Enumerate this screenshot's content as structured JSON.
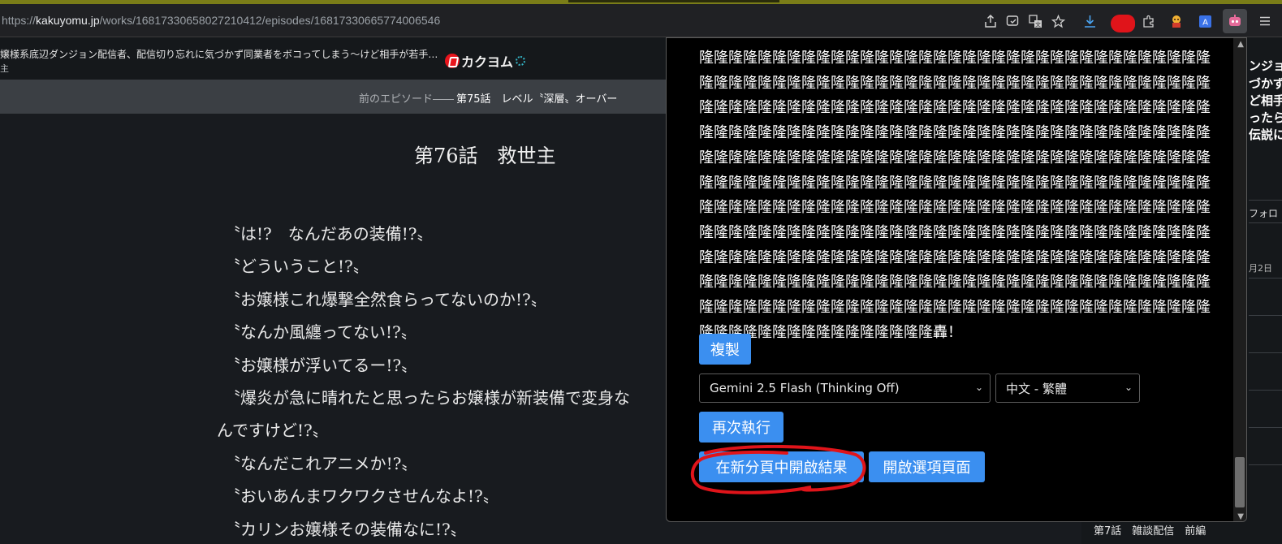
{
  "browser": {
    "url_scheme": "https://",
    "url_host": "kakuyomu.jp",
    "url_path": "/works/16817330658027210412/episodes/16817330665774006546",
    "toolbar_icons": [
      "share-icon",
      "install-icon",
      "translate-icon",
      "bookmark-star-icon",
      "download-icon",
      "extension-red-icon",
      "extensions-puzzle-icon",
      "extension-character-icon",
      "extension-translate-icon",
      "extension-bot-icon",
      "menu-icon"
    ]
  },
  "site": {
    "series_title": "嬢様系底辺ダンジョン配信者、配信切り忘れに気づかず同業者をボコってしまう〜けど相手が若手…",
    "series_sub": "主",
    "logo_text": "カクヨム"
  },
  "nav": {
    "prev_label": "前のエピソード――",
    "current_label": "第75話　レベル〝深層〟オーバー"
  },
  "episode": {
    "title": "第76話　救世主",
    "lines": [
      "〝は!?　なんだあの装備!?〟",
      "〝どういうこと!?〟",
      "〝お嬢様これ爆撃全然食らってないのか!?〟",
      "〝なんか風纏ってない!?〟",
      "〝お嬢様が浮いてるー!?〟",
      "〝爆炎が急に晴れたと思ったらお嬢様が新装備で変身な",
      "んですけど!?〟",
      "〝なんだこれアニメか!?〟",
      "〝おいあんまワクワクさせんなよ!?〟",
      "〝カリンお嬢様その装備なに!?〟"
    ]
  },
  "right_panel": {
    "heading_lines": [
      "ンジョ",
      "づかず",
      "ど相手",
      "ったら",
      "伝説に"
    ],
    "follow_label": "フォロ",
    "date_text": "月2日",
    "bottom_link": "第7話　雑談配信　前編"
  },
  "popup": {
    "result_text": "隆隆隆隆隆隆隆隆隆隆隆隆隆隆隆隆隆隆隆隆隆隆隆隆隆隆隆隆隆隆隆隆隆隆隆隆隆隆隆隆隆隆隆隆隆隆隆隆隆隆隆隆隆隆隆隆隆隆隆隆隆隆隆隆隆隆隆隆隆隆隆隆隆隆隆隆隆隆隆隆隆隆隆隆隆隆隆隆隆隆隆隆隆隆隆隆隆隆隆隆隆隆隆隆隆隆隆隆隆隆隆隆隆隆隆隆隆隆隆隆隆隆隆隆隆隆隆隆隆隆隆隆隆隆隆隆隆隆隆隆隆隆隆隆隆隆隆隆隆隆隆隆隆隆隆隆隆隆隆隆隆隆隆隆隆隆隆隆隆隆隆隆隆隆隆隆隆隆隆隆隆隆隆隆隆隆隆隆隆隆隆隆隆隆隆隆隆隆隆隆隆隆隆隆隆隆隆隆隆隆隆隆隆隆隆隆隆隆隆隆隆隆隆隆隆隆隆隆隆隆隆隆隆隆隆隆隆隆隆隆隆隆隆隆隆隆隆隆隆隆隆隆隆隆隆隆隆隆隆隆隆隆隆隆隆隆隆隆隆隆隆隆隆隆隆隆隆隆隆隆隆隆隆隆隆隆隆隆隆隆隆隆隆隆隆隆隆隆隆隆隆隆隆隆隆隆隆隆隆隆隆隆隆隆隆隆隆隆隆隆隆隆隆隆隆隆隆隆隆隆隆隆隆隆隆隆隆隆隆隆隆隆隆隆隆隆隆隆隆隆隆隆隆隆隆隆隆隆隆隆隆隆隆隆隆隆隆隆隆隆隆隆隆隆隆隆隆隆隆隆隆隆隆隆隆隆隆隆隆隆隆隆隆隆隆隆隆隆隆隆隆轟！",
    "copy_label": "複製",
    "model_select": "Gemini 2.5 Flash (Thinking Off)",
    "language_select": "中文 - 繁體",
    "rerun_label": "再次執行",
    "open_result_label": "在新分頁中開啟結果",
    "open_options_label": "開啟選項頁面"
  },
  "colors": {
    "accent_button": "#3b8ff0",
    "annotation_circle": "#e0141a",
    "logo_red": "#e8141c"
  }
}
